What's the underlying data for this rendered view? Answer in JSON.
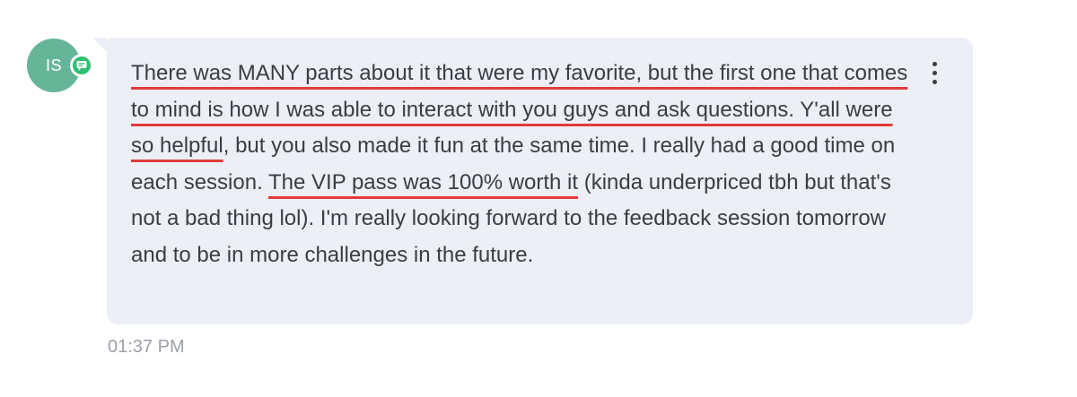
{
  "sender": {
    "initials": "IS",
    "avatar_color": "#66b598",
    "badge_icon": "chat-bubble-icon",
    "badge_color": "#2fbf71"
  },
  "message": {
    "segments": [
      {
        "text": "There was MANY parts about it that were my favorite, but the first one that comes to mind is how I was able to interact with you guys and ask questions. Y'all were so helpful",
        "underlined": true
      },
      {
        "text": ", but you also made it fun at the same time. I really had a good time on each session. ",
        "underlined": false
      },
      {
        "text": "The VIP pass was 100% worth it",
        "underlined": true
      },
      {
        "text": " (kinda underpriced tbh but that's not a bad thing lol). I'm really looking forward to the feedback session tomorrow and to be in more challenges in the future.",
        "underlined": false
      }
    ],
    "underline_color": "#e23a3a",
    "bubble_color": "#edeff6",
    "menu_icon": "more-vertical-icon",
    "timestamp": "01:37 PM"
  }
}
